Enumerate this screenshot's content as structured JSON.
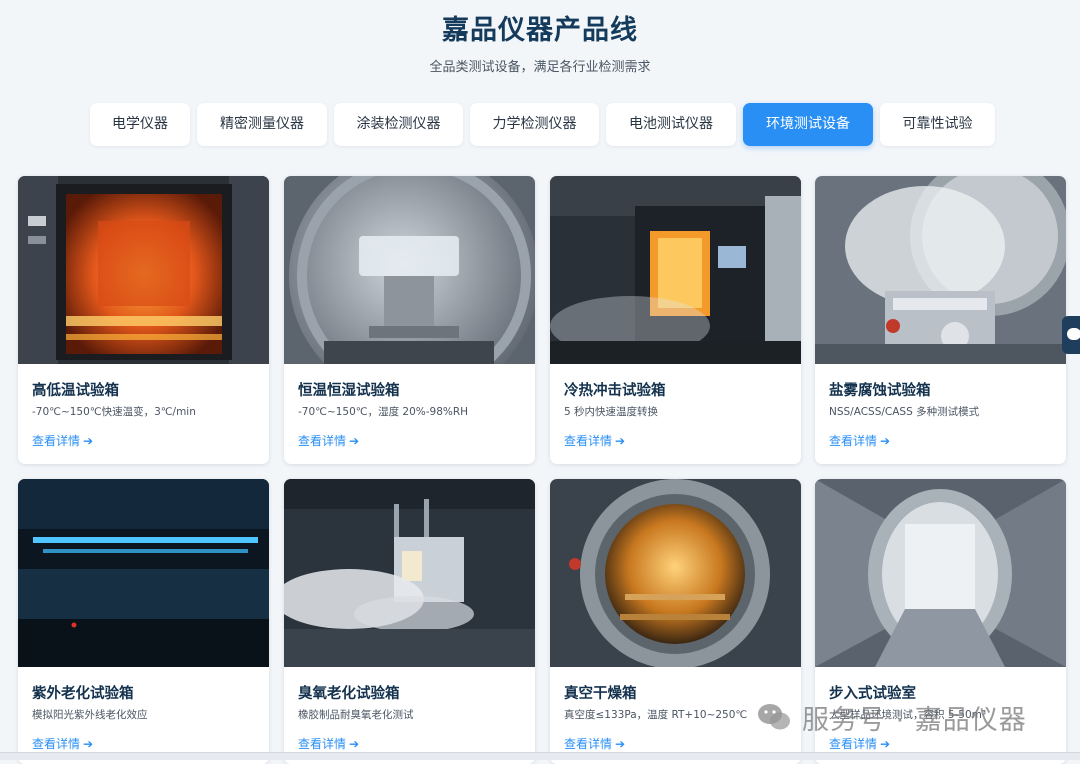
{
  "header": {
    "title": "嘉品仪器产品线",
    "subtitle": "全品类测试设备，满足各行业检测需求"
  },
  "tabs": [
    {
      "label": "电学仪器",
      "active": false
    },
    {
      "label": "精密测量仪器",
      "active": false
    },
    {
      "label": "涂装检测仪器",
      "active": false
    },
    {
      "label": "力学检测仪器",
      "active": false
    },
    {
      "label": "电池测试仪器",
      "active": false
    },
    {
      "label": "环境测试设备",
      "active": true
    },
    {
      "label": "可靠性试验",
      "active": false
    }
  ],
  "products": [
    {
      "title": "高低温试验箱",
      "desc": "-70℃~150℃快速温变，3℃/min",
      "link": "查看详情",
      "image": "furnace-chamber-image"
    },
    {
      "title": "恒温恒湿试验箱",
      "desc": "-70℃~150℃，湿度 20%-98%RH",
      "link": "查看详情",
      "image": "humidity-chamber-image"
    },
    {
      "title": "冷热冲击试验箱",
      "desc": "5 秒内快速温度转换",
      "link": "查看详情",
      "image": "thermal-shock-image"
    },
    {
      "title": "盐雾腐蚀试验箱",
      "desc": "NSS/ACSS/CASS 多种测试模式",
      "link": "查看详情",
      "image": "salt-spray-image"
    },
    {
      "title": "紫外老化试验箱",
      "desc": "模拟阳光紫外线老化效应",
      "link": "查看详情",
      "image": "uv-aging-image"
    },
    {
      "title": "臭氧老化试验箱",
      "desc": "橡胶制品耐臭氧老化测试",
      "link": "查看详情",
      "image": "ozone-aging-image"
    },
    {
      "title": "真空干燥箱",
      "desc": "真空度≤133Pa，温度 RT+10~250℃",
      "link": "查看详情",
      "image": "vacuum-oven-image"
    },
    {
      "title": "步入式试验室",
      "desc": "大型样品环境测试，容积 5-50m³",
      "link": "查看详情",
      "image": "walk-in-room-image"
    }
  ],
  "watermark": {
    "text": "服务号 · 嘉品仪器",
    "icon": "wechat-icon"
  },
  "colors": {
    "accent": "#2a8ff5",
    "title": "#143a5c",
    "background": "#f3f6f9"
  }
}
